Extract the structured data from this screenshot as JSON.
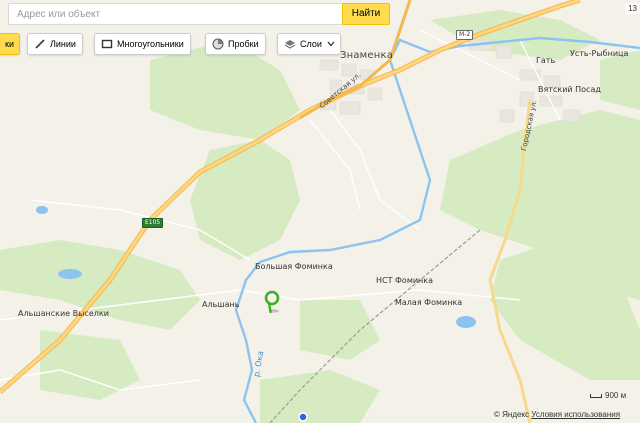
{
  "search": {
    "placeholder": "Адрес или объект",
    "button": "Найти"
  },
  "toolbar": {
    "cut_label": "ки",
    "lines": "Линии",
    "polygons": "Многоугольники",
    "traffic": "Пробки",
    "layers": "Слои"
  },
  "top_right_label": "13",
  "map_labels": {
    "znamenka": "Знаменка",
    "sovetskaya": "Советская ул.",
    "gat": "Гать",
    "ust_rybnitsa": "Усть-Рыбница",
    "vyatskiy_posad": "Вятский Посад",
    "gorodskaya": "Городская ул.",
    "bolshaya_fominka": "Большая Фоминка",
    "nst_fominka": "НСТ Фоминка",
    "malaya_fominka": "Малая Фоминка",
    "alshan": "Альшань",
    "alshanskie_vyselki": "Альшанские Выселки",
    "river_oka": "р. Ока",
    "e105": "E105",
    "m2": "М-2"
  },
  "scale": {
    "label": "900 м"
  },
  "copyright": {
    "yandex": "© Яндекс",
    "terms": "Условия использования"
  },
  "colors": {
    "background": "#f4f1e9",
    "forest": "#d8ecc4",
    "highway": "#f5c86b",
    "river": "#7cb6e6",
    "marker": "#3fae29"
  }
}
